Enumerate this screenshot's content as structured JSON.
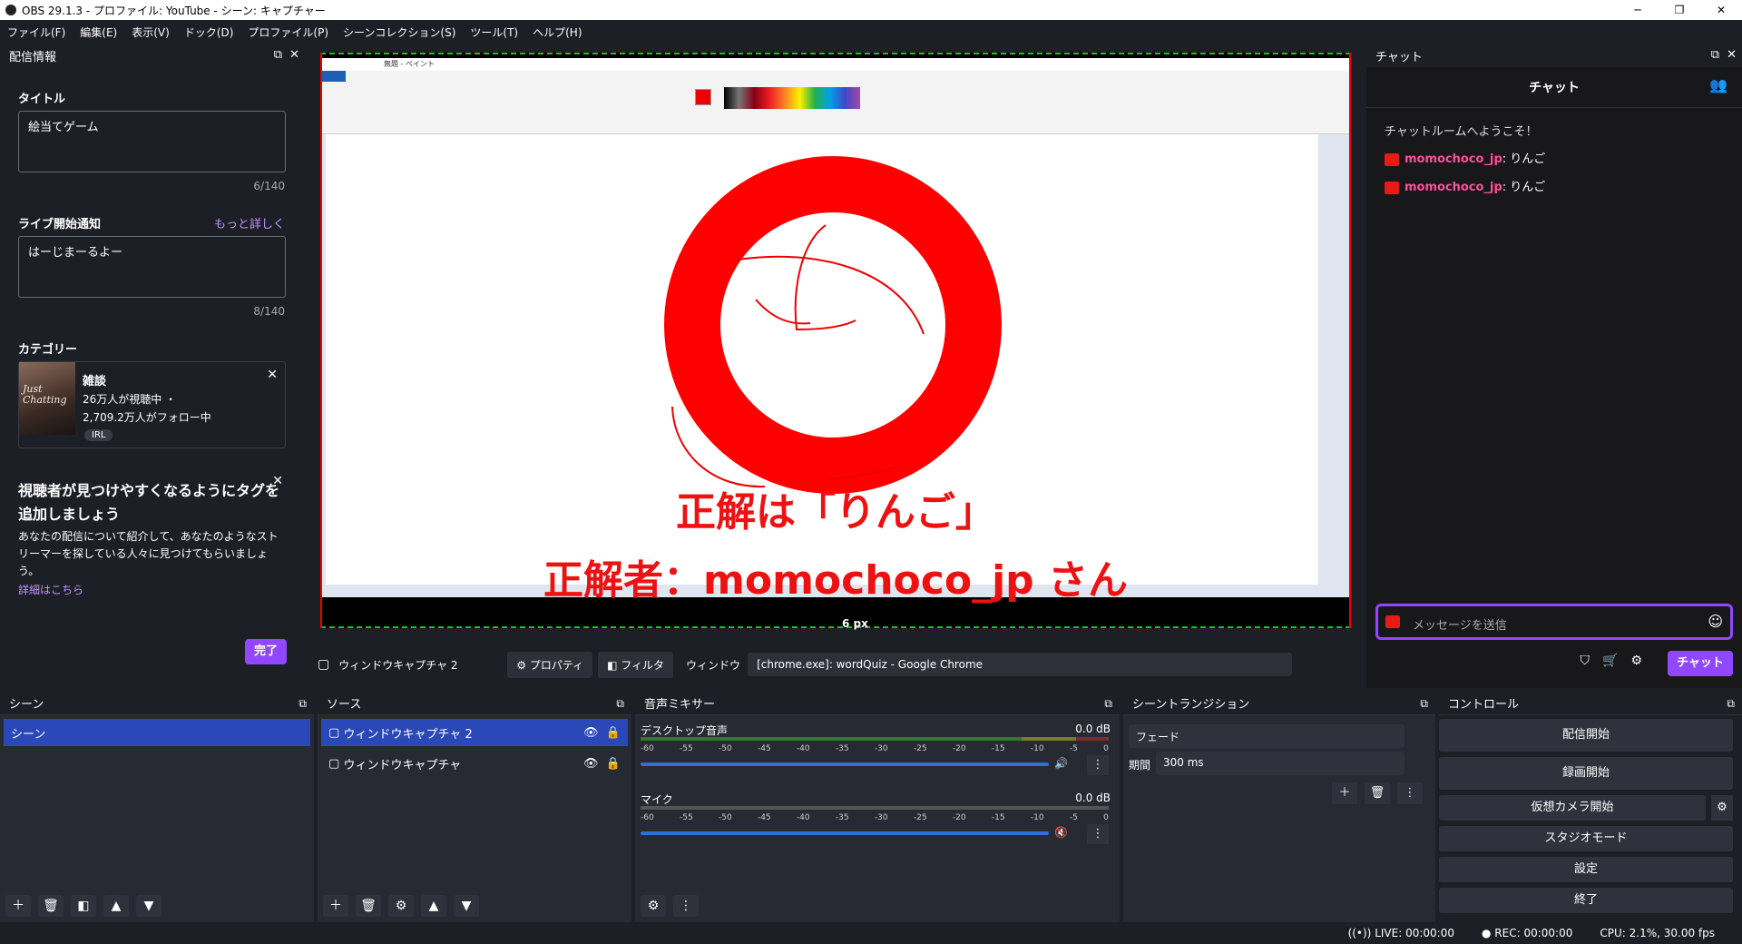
{
  "window": {
    "title": "OBS 29.1.3 - プロファイル: YouTube - シーン: キャプチャー",
    "min": "─",
    "max": "❐",
    "close": "✕"
  },
  "menu": [
    "ファイル(F)",
    "編集(E)",
    "表示(V)",
    "ドック(D)",
    "プロファイル(P)",
    "シーンコレクション(S)",
    "ツール(T)",
    "ヘルプ(H)"
  ],
  "stream_info": {
    "header": "配信情報",
    "title_label": "タイトル",
    "title_value": "絵当てゲーム",
    "title_count": "6/140",
    "notice_label": "ライブ開始通知",
    "more": "もっと詳しく",
    "notice_value": "はーじまーるよー",
    "notice_count": "8/140",
    "category_label": "カテゴリー",
    "cat_name": "雑談",
    "cat_viewers": "26万人が視聴中 ・",
    "cat_followers": "2,709.2万人がフォロー中",
    "cat_tag": "IRL",
    "cat_img_text": "Just Chatting",
    "tag_title": "視聴者が見つけやすくなるようにタグを追加しましょう",
    "tag_desc": "あなたの配信について紹介して、あなたのようなストリーマーを探している人々に見つけてもらいましょう。",
    "tag_link": "詳細はこちら",
    "done": "完了"
  },
  "preview": {
    "answer": "正解は「りんご」",
    "winner": "正解者：momochoco_jp さん",
    "px_label": "6 px",
    "paint_title": "無題 - ペイント"
  },
  "source_bar": {
    "name": "ウィンドウキャプチャ 2",
    "props": "プロパティ",
    "filters": "フィルタ",
    "window_label": "ウィンドウ",
    "window_value": "[chrome.exe]: wordQuiz - Google Chrome"
  },
  "chat": {
    "header": "チャット",
    "title": "チャット",
    "welcome": "チャットルームへようこそ！",
    "messages": [
      {
        "user": "momochoco_jp",
        "text": "りんご"
      },
      {
        "user": "momochoco_jp",
        "text": "りんご"
      }
    ],
    "placeholder": "メッセージを送信",
    "button": "チャット"
  },
  "scenes": {
    "header": "シーン",
    "items": [
      "シーン"
    ]
  },
  "sources": {
    "header": "ソース",
    "items": [
      "ウィンドウキャプチャ 2",
      "ウィンドウキャプチャ"
    ]
  },
  "mixer": {
    "header": "音声ミキサー",
    "channels": [
      {
        "name": "デスクトップ音声",
        "db": "0.0 dB"
      },
      {
        "name": "マイク",
        "db": "0.0 dB"
      }
    ],
    "ticks": [
      "-60",
      "-55",
      "-50",
      "-45",
      "-40",
      "-35",
      "-30",
      "-25",
      "-20",
      "-15",
      "-10",
      "-5",
      "0"
    ]
  },
  "transitions": {
    "header": "シーントランジション",
    "type": "フェード",
    "duration_label": "期間",
    "duration": "300 ms"
  },
  "controls": {
    "header": "コントロール",
    "buttons": [
      "配信開始",
      "録画開始",
      "仮想カメラ開始",
      "スタジオモード",
      "設定",
      "終了"
    ]
  },
  "status": {
    "live": "LIVE: 00:00:00",
    "rec": "REC: 00:00:00",
    "cpu": "CPU: 2.1%, 30.00 fps"
  },
  "colors": {
    "accent": "#9147ff",
    "selected": "#2a48b8",
    "chat_user": "#ff4f9a",
    "red": "#ff0000"
  }
}
